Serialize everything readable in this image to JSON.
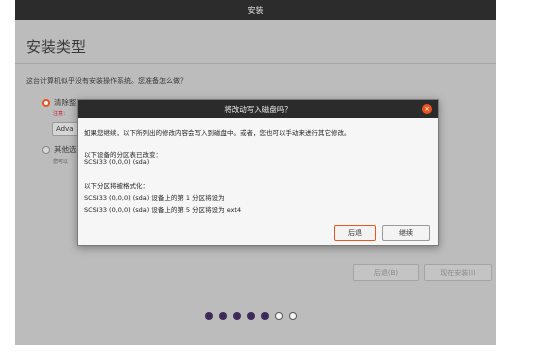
{
  "window": {
    "title": "安装",
    "heading": "安装类型",
    "question": "这台计算机似乎没有安装操作系统。您准备怎么做？"
  },
  "options": {
    "erase_label": "清除整",
    "erase_note": "注意：",
    "advanced_label": "Adva",
    "other_label": "其他选",
    "other_note": "您可以"
  },
  "nav": {
    "back_label": "后退(B)",
    "install_label": "现在安装(I)"
  },
  "progress": {
    "total_steps": 7,
    "completed_steps": 5
  },
  "dialog": {
    "title": "将改动写入磁盘吗？",
    "close_glyph": "×",
    "intro": "如果您继续，以下所列出的修改内容会写入到磁盘中。或者，您也可以手动来进行其它修改。",
    "changed_heading": "以下设备的分区表已改变：",
    "changed_device": "SCSI33 (0,0,0) (sda)",
    "format_heading": "以下分区将被格式化：",
    "format_line1": "SCSI33 (0,0,0) (sda) 设备上的第 1 分区将设为",
    "format_line2": "SCSI33 (0,0,0) (sda) 设备上的第 5 分区将设为 ext4",
    "back_button": "后退",
    "continue_button": "继续"
  },
  "colors": {
    "accent": "#e95420",
    "titlebar": "#2c2c2c",
    "background_dimmed": "#bcbcbc",
    "progress_dot": "#3c2a5a"
  }
}
